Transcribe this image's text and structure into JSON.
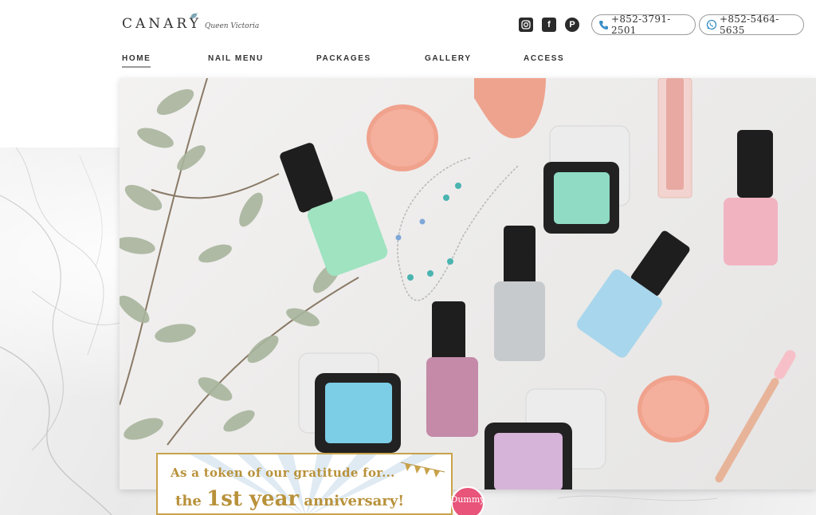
{
  "brand": {
    "name": "CANARY",
    "subtitle": "Queen Victoria"
  },
  "social": [
    {
      "name": "instagram-icon",
      "glyph": "◎"
    },
    {
      "name": "facebook-icon",
      "glyph": "f"
    },
    {
      "name": "pinterest-icon",
      "glyph": "P"
    }
  ],
  "contact": {
    "phone": "+852-3791-2501",
    "whatsapp": "+852-5464-5635"
  },
  "nav": {
    "items": [
      "HOME",
      "NAIL MENU",
      "PACKAGES",
      "GALLERY",
      "ACCESS"
    ],
    "active": "HOME"
  },
  "banner": {
    "line1": "As a token of our gratitude for...",
    "line2_pre": "the ",
    "line2_num": "1st",
    "line2_year": " year",
    "line2_post": " anniversary!",
    "badge": "Dummy"
  },
  "colors": {
    "accent_gold": "#b8913a",
    "phone_icon": "#3a8fc7",
    "whatsapp_icon": "#3a8fc7",
    "badge": "#e8547a"
  }
}
